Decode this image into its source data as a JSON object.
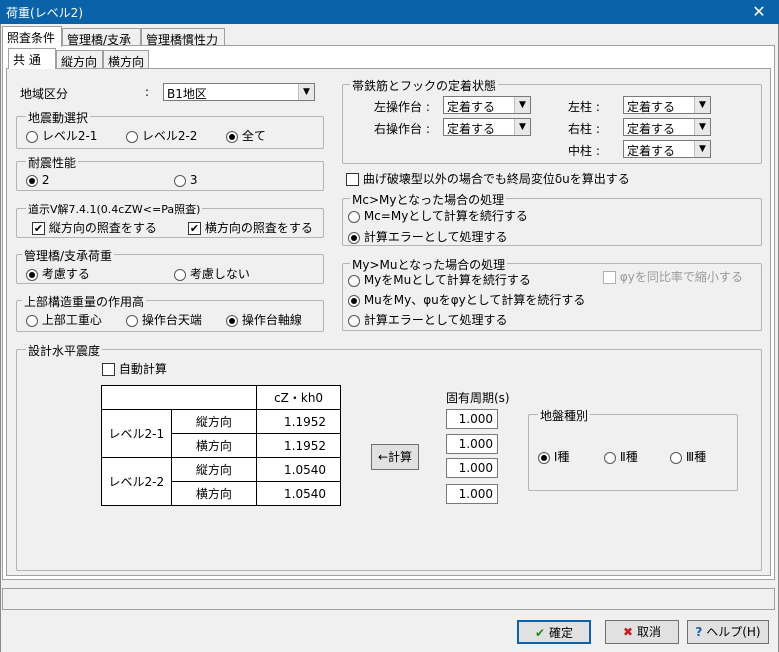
{
  "window": {
    "title": "荷重(レベル2)",
    "close_label": "✕"
  },
  "tabs_main": [
    "照査条件",
    "管理橋/支承",
    "管理橋慣性力"
  ],
  "tabs_sub": [
    "共 通",
    "縦方向",
    "横方向"
  ],
  "region": {
    "label": "地域区分",
    "colon": ":",
    "value": "B1地区"
  },
  "quake": {
    "title": "地震動選択",
    "options": [
      "レベル2-1",
      "レベル2-2",
      "全て"
    ],
    "selected": 2
  },
  "seismic_perf": {
    "title": "耐震性能",
    "options": [
      "2",
      "3"
    ],
    "selected": 0
  },
  "road": {
    "title": "道示Ⅴ解7.4.1(0.4cZW<=Pa照査)",
    "check_long": "縦方向の照査をする",
    "check_trans": "横方向の照査をする"
  },
  "bridge_load": {
    "title": "管理橋/支承荷重",
    "options": [
      "考慮する",
      "考慮しない"
    ],
    "selected": 0
  },
  "upper_weight": {
    "title": "上部構造重量の作用高",
    "options": [
      "上部工重心",
      "操作台天端",
      "操作台軸線"
    ],
    "selected": 2
  },
  "anchor": {
    "title": "帯鉄筋とフックの定着状態",
    "rows": [
      {
        "label": "左操作台 :",
        "value": "定着する"
      },
      {
        "label": "右操作台 :",
        "value": "定着する"
      },
      {
        "label": "左柱 :",
        "value": "定着する"
      },
      {
        "label": "右柱 :",
        "value": "定着する"
      },
      {
        "label": "中柱 :",
        "value": "定着する"
      }
    ]
  },
  "bend_check": "曲げ破壊型以外の場合でも終局変位δuを算出する",
  "mc_my": {
    "title": "Mc>Myとなった場合の処理",
    "options": [
      "Mc=Myとして計算を続行する",
      "計算エラーとして処理する"
    ],
    "selected": 1
  },
  "my_mu": {
    "title": "My>Muとなった場合の処理",
    "options": [
      "MyをMuとして計算を続行する",
      "MuをMy、φuをφyとして計算を続行する",
      "計算エラーとして処理する"
    ],
    "selected": 1,
    "phi_check": "φyを同比率で縮小する"
  },
  "design": {
    "title": "設計水平震度",
    "auto_calc": "自動計算",
    "header": "cZ・kh0",
    "levels": [
      "レベル2-1",
      "レベル2-2"
    ],
    "dirs": [
      "縦方向",
      "横方向",
      "縦方向",
      "横方向"
    ],
    "values": [
      "1.1952",
      "1.1952",
      "1.0540",
      "1.0540"
    ],
    "calc_button": "←計算",
    "period_label": "固有周期(s)",
    "periods": [
      "1.000",
      "1.000",
      "1.000",
      "1.000"
    ]
  },
  "ground": {
    "title": "地盤種別",
    "options": [
      "Ⅰ種",
      "Ⅱ種",
      "Ⅲ種"
    ],
    "selected": 0
  },
  "buttons": {
    "ok": "確定",
    "cancel": "取消",
    "help": "ヘルプ(H)"
  }
}
